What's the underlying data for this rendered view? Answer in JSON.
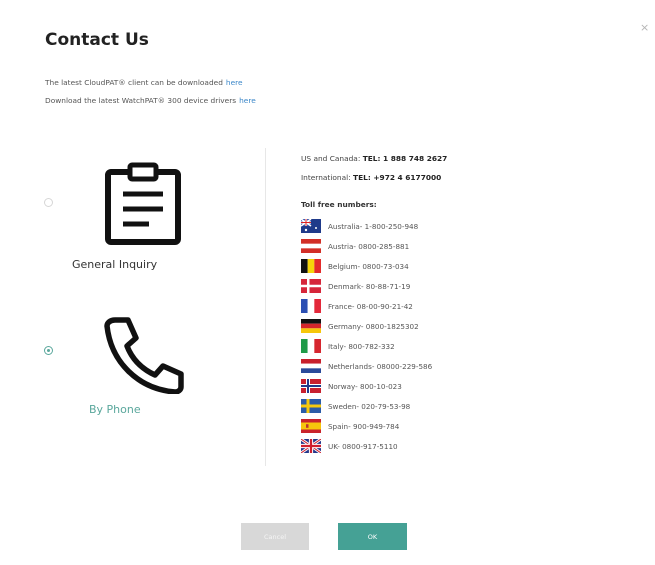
{
  "dialog": {
    "title": "Contact Us",
    "close_glyph": "×",
    "download_line_1": "The latest CloudPAT® client can be downloaded",
    "download_line_1_link": "here",
    "download_line_2": "Download the latest WatchPAT® 300 device drivers",
    "download_line_2_link": "here"
  },
  "options": [
    {
      "label": "General Inquiry",
      "icon": "clipboard-icon",
      "selected": false
    },
    {
      "label": "By Phone",
      "icon": "phone-icon",
      "selected": true
    }
  ],
  "phone_info": {
    "us_canada_label": "US and Canada:",
    "us_canada_value": "TEL: 1 888 748 2627",
    "international_label": "International:",
    "international_value": "TEL: +972 4 6177000",
    "toll_free_heading": "Toll free numbers:",
    "toll_free": [
      {
        "country": "Australia",
        "text": "Australia- 1-800-250-948",
        "flag": "australia-flag-icon"
      },
      {
        "country": "Austria",
        "text": "Austria- 0800-285-881",
        "flag": "austria-flag-icon"
      },
      {
        "country": "Belgium",
        "text": "Belgium- 0800-73-034",
        "flag": "belgium-flag-icon"
      },
      {
        "country": "Denmark",
        "text": "Denmark- 80-88-71-19",
        "flag": "denmark-flag-icon"
      },
      {
        "country": "France",
        "text": "France- 08-00-90-21-42",
        "flag": "france-flag-icon"
      },
      {
        "country": "Germany",
        "text": "Germany- 0800-1825302",
        "flag": "germany-flag-icon"
      },
      {
        "country": "Italy",
        "text": "Italy- 800-782-332",
        "flag": "italy-flag-icon"
      },
      {
        "country": "Netherlands",
        "text": "Netherlands- 08000-229-586",
        "flag": "netherlands-flag-icon"
      },
      {
        "country": "Norway",
        "text": "Norway- 800-10-023",
        "flag": "norway-flag-icon"
      },
      {
        "country": "Sweden",
        "text": "Sweden- 020-79-53-98",
        "flag": "sweden-flag-icon"
      },
      {
        "country": "Spain",
        "text": "Spain- 900-949-784",
        "flag": "spain-flag-icon"
      },
      {
        "country": "UK",
        "text": "UK- 0800-917-5110",
        "flag": "uk-flag-icon"
      }
    ]
  },
  "buttons": {
    "cancel": "Cancel",
    "ok": "OK"
  },
  "colors": {
    "accent": "#45a195",
    "link": "#3a86c8",
    "cancel_bg": "#d8d8d8"
  }
}
